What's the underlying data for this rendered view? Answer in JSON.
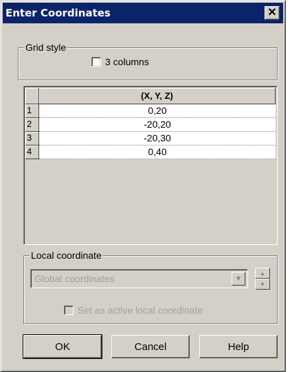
{
  "window": {
    "title": "Enter Coordinates",
    "close_glyph": "✕"
  },
  "grid_style": {
    "legend": "Grid style",
    "checkbox_label": "3 columns",
    "checked": false
  },
  "table": {
    "column_header": "(X, Y, Z)",
    "rows": [
      {
        "index": "1",
        "value": "0,20"
      },
      {
        "index": "2",
        "value": "-20,20"
      },
      {
        "index": "3",
        "value": "-20,30"
      },
      {
        "index": "4",
        "value": "0,40"
      }
    ]
  },
  "local_coordinate": {
    "legend": "Local coordinate",
    "selected": "Global coordinates",
    "enabled": false,
    "checkbox_label": "Set as active local coordinate",
    "checked": false
  },
  "buttons": {
    "ok": "OK",
    "cancel": "Cancel",
    "help": "Help"
  },
  "colors": {
    "titlebar": "#0a246a",
    "face": "#d4d0c8",
    "disabled_text": "#a0a0a0"
  }
}
